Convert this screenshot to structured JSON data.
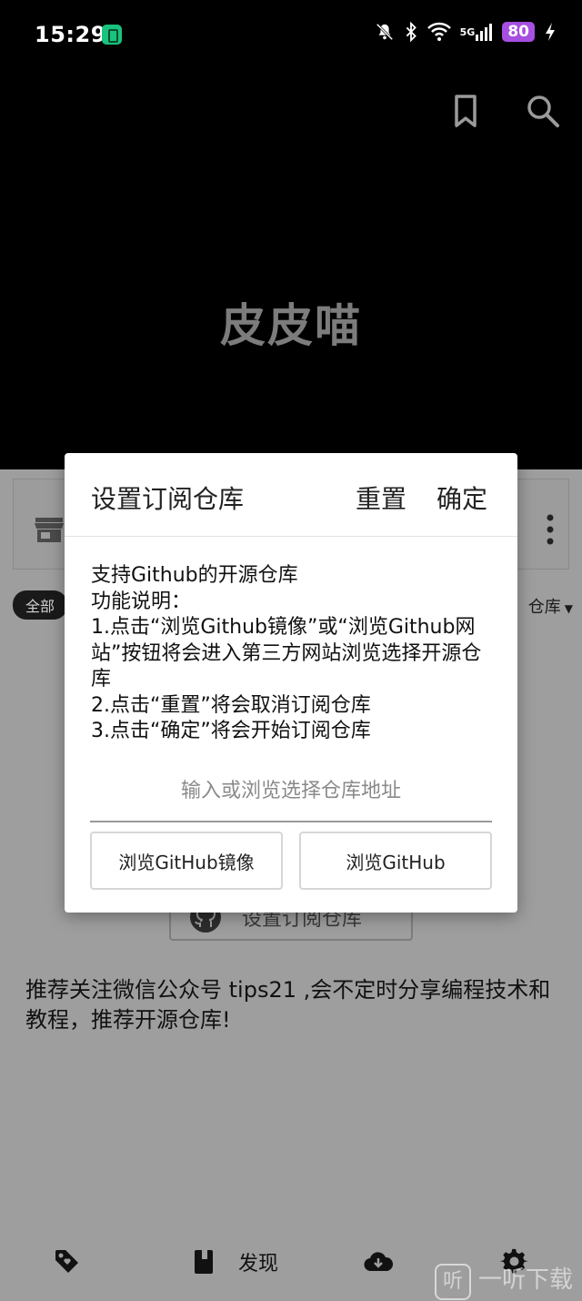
{
  "status_bar": {
    "time": "15:29",
    "signal_label": "5G",
    "battery": "80"
  },
  "header": {
    "app_title": "皮皮喵"
  },
  "background_page": {
    "filter_all": "全部",
    "repo_dropdown": "仓库",
    "set_subscription_button": "设置订阅仓库",
    "recommendation": "推荐关注微信公众号 tips21 ,会不定时分享编程技术和教程，推荐开源仓库!"
  },
  "dialog": {
    "title": "设置订阅仓库",
    "reset_label": "重置",
    "confirm_label": "确定",
    "description_lines": [
      "支持Github的开源仓库",
      "功能说明：",
      "1.点击“浏览Github镜像”或“浏览Github网站”按钮将会进入第三方网站浏览选择开源仓库",
      "2.点击“重置”将会取消订阅仓库",
      "3.点击“确定”将会开始订阅仓库"
    ],
    "input_placeholder": "输入或浏览选择仓库地址",
    "input_value": "",
    "browse_mirror_label": "浏览GitHub镜像",
    "browse_github_label": "浏览GitHub"
  },
  "bottom_nav": {
    "discover_label": "发现"
  },
  "watermark": {
    "badge": "听",
    "text": "一听下载"
  }
}
